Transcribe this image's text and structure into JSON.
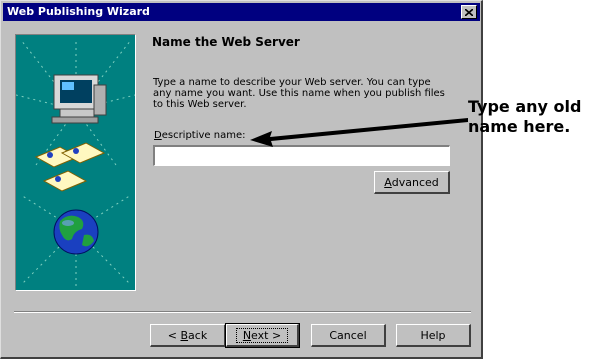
{
  "window": {
    "title": "Web Publishing Wizard"
  },
  "page": {
    "title": "Name the Web Server",
    "description": "Type a name to describe your Web server. You can type any name you want. Use this name when you publish files to this Web server.",
    "field_label_mnemonic": "D",
    "field_label_rest": "escriptive name:",
    "field_value": ""
  },
  "buttons": {
    "advanced_mnemonic": "A",
    "advanced_rest": "dvanced",
    "back_arrow": "< ",
    "back_mnemonic": "B",
    "back_rest": "ack",
    "next_mnemonic": "N",
    "next_rest": "ext >",
    "cancel": "Cancel",
    "help": "Help"
  },
  "annotation": {
    "line1": "Type any old",
    "line2": "name here."
  },
  "icons": {
    "close": "close-icon",
    "computer": "computer-icon",
    "documents": "documents-icon",
    "globe": "globe-icon",
    "arrow": "annotation-arrow"
  },
  "colors": {
    "titlebar": "#000080",
    "dialog": "#c0c0c0",
    "sidebar": "#008080"
  }
}
